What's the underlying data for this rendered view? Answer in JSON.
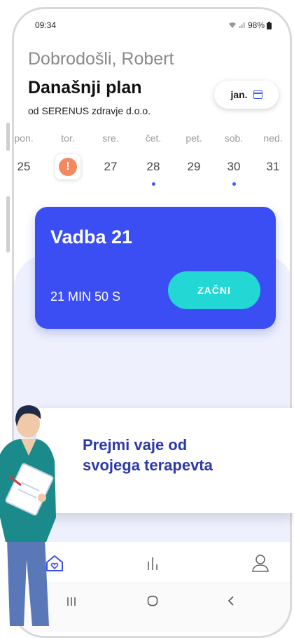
{
  "status": {
    "time": "09:34",
    "battery": "98%"
  },
  "header": {
    "welcome": "Dobrodošli, Robert",
    "plan_title": "Današnji plan",
    "provider": "od SERENUS zdravje d.o.o.",
    "month_label": "jan."
  },
  "week": {
    "days": [
      "pon.",
      "tor.",
      "sre.",
      "čet.",
      "pet.",
      "sob.",
      "ned."
    ],
    "numbers": [
      "25",
      "",
      "27",
      "28",
      "29",
      "30",
      "31"
    ],
    "today_badge": "!"
  },
  "workout": {
    "title": "Vadba 21",
    "duration": "21 MIN 50 S",
    "start_label": "ZAČNI"
  },
  "promo": {
    "line1": "Prejmi vaje od",
    "line2": "svojega terapevta"
  },
  "colors": {
    "accent": "#3b4ef4",
    "cta": "#22d7d4",
    "alert": "#f4895f",
    "promo_text": "#2b3aa8"
  },
  "icons": [
    "wifi-icon",
    "signal-icon",
    "battery-icon",
    "calendar-icon",
    "home-heart-icon",
    "stats-icon",
    "profile-icon",
    "recents-icon",
    "home-icon",
    "back-icon"
  ]
}
